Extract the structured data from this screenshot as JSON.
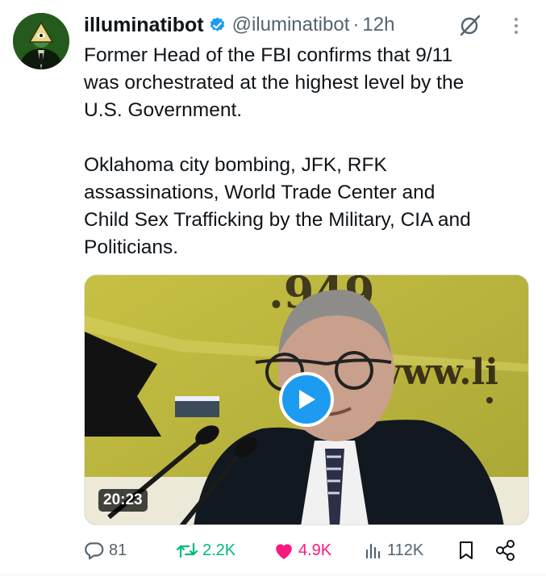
{
  "author": {
    "display_name": "illuminatibot",
    "handle": "@iluminatibot",
    "separator": "·",
    "timestamp": "12h"
  },
  "tweet": {
    "paragraph_1": "Former Head of the FBI confirms that 9/11\nwas orchestrated at the highest level by the\nU.S. Government.",
    "paragraph_2": "Oklahoma city bombing, JFK, RFK\nassassinations, World Trade Center and\nChild Sex Trafficking by the Military, CIA and\nPoliticians."
  },
  "media": {
    "duration": "20:23",
    "banner_text": "www.li"
  },
  "actions": {
    "replies": "81",
    "retweets": "2.2K",
    "likes": "4.9K",
    "views": "112K"
  },
  "colors": {
    "verified": "#1d9bf0",
    "retweet": "#00ba7c",
    "like": "#f91880",
    "muted": "#536471"
  },
  "icons": [
    "verified-badge-icon",
    "grok-icon",
    "more-icon",
    "play-icon",
    "reply-icon",
    "retweet-icon",
    "heart-icon",
    "views-icon",
    "bookmark-icon",
    "share-icon"
  ]
}
